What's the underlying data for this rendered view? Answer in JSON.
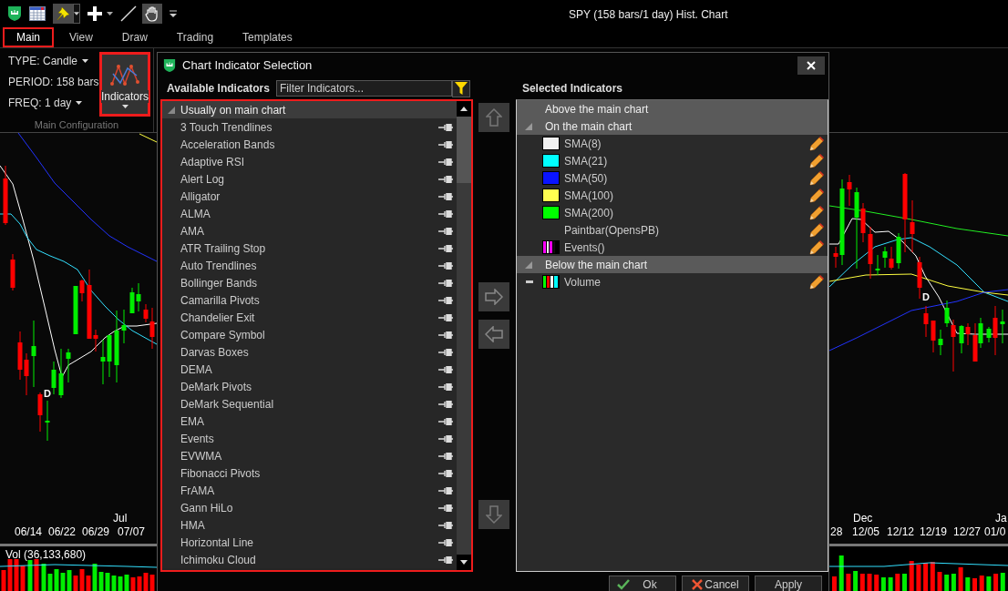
{
  "toolbar": {
    "title": "SPY (158 bars/1 day) Hist. Chart"
  },
  "menu_tabs": [
    {
      "label": "Main",
      "selected": true,
      "highlighted": true
    },
    {
      "label": "View",
      "selected": false,
      "highlighted": false
    },
    {
      "label": "Draw",
      "selected": false,
      "highlighted": false
    },
    {
      "label": "Trading",
      "selected": false,
      "highlighted": false
    },
    {
      "label": "Templates",
      "selected": false,
      "highlighted": false
    }
  ],
  "ribbon": {
    "settings": [
      {
        "label": "TYPE: Candle"
      },
      {
        "label": "PERIOD: 158 bars"
      },
      {
        "label": "FREQ: 1 day"
      }
    ],
    "indicators_button": {
      "label": "Indicators",
      "highlighted": true
    },
    "group_caption": "Main Configuration"
  },
  "chart": {
    "left_month_labels": [
      "Jul"
    ],
    "left_date_labels": [
      "06/14",
      "06/22",
      "06/29",
      "07/07"
    ],
    "right_month_labels": [
      "Dec",
      "Ja"
    ],
    "right_date_labels": [
      "28",
      "12/05",
      "12/12",
      "12/19",
      "12/27",
      "01/0"
    ],
    "event_markers": [
      "D",
      "D"
    ]
  },
  "volume_panel": {
    "label": "Vol (36,133,680)"
  },
  "dialog": {
    "title": "Chart Indicator Selection",
    "available": {
      "heading": "Available Indicators",
      "filter": {
        "placeholder": "Filter Indicators..."
      },
      "highlighted": true,
      "groups": [
        {
          "label": "Usually on main chart",
          "expanded": true,
          "items": [
            "3 Touch Trendlines",
            "Acceleration Bands",
            "Adaptive RSI",
            "Alert Log",
            "Alligator",
            "ALMA",
            "AMA",
            "ATR Trailing Stop",
            "Auto Trendlines",
            "Bollinger Bands",
            "Camarilla Pivots",
            "Chandelier Exit",
            "Compare Symbol",
            "Darvas Boxes",
            "DEMA",
            "DeMark Pivots",
            "DeMark Sequential",
            "EMA",
            "Events",
            "EVWMA",
            "Fibonacci Pivots",
            "FrAMA",
            "Gann HiLo",
            "HMA",
            "Horizontal Line",
            "Ichimoku Cloud"
          ]
        }
      ]
    },
    "selected": {
      "heading": "Selected Indicators",
      "groups": [
        {
          "label": "Above the main chart",
          "expanded": false
        },
        {
          "label": "On the main chart",
          "expanded": true,
          "items": [
            {
              "label": "SMA(8)",
              "kind": "solid",
              "color": "#f0f0f0",
              "collapsible": false
            },
            {
              "label": "SMA(21)",
              "kind": "solid",
              "color": "#00ffff",
              "collapsible": false
            },
            {
              "label": "SMA(50)",
              "kind": "solid",
              "color": "#0a14ff",
              "collapsible": false
            },
            {
              "label": "SMA(100)",
              "kind": "solid",
              "color": "#ffff50",
              "collapsible": false
            },
            {
              "label": "SMA(200)",
              "kind": "solid",
              "color": "#00ff00",
              "collapsible": false
            },
            {
              "label": "Paintbar(OpensPB)",
              "kind": "none",
              "collapsible": false
            },
            {
              "label": "Events()",
              "kind": "events",
              "collapsible": false
            }
          ]
        },
        {
          "label": "Below the main chart",
          "expanded": true,
          "items": [
            {
              "label": "Volume",
              "kind": "volume",
              "collapsible": true
            }
          ]
        }
      ]
    },
    "buttons": [
      {
        "label": "Ok",
        "kind": "ok"
      },
      {
        "label": "Cancel",
        "kind": "cancel"
      },
      {
        "label": "Apply",
        "kind": "plain"
      }
    ]
  }
}
